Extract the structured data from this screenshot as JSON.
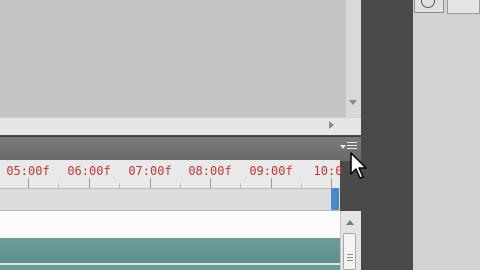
{
  "timeline": {
    "timecodes": [
      {
        "label": "05:00f"
      },
      {
        "label": "06:00f"
      },
      {
        "label": "07:00f"
      },
      {
        "label": "08:00f"
      },
      {
        "label": "09:00f"
      },
      {
        "label": "10:0"
      }
    ]
  },
  "icons": {
    "panel_menu": "panel-menu-icon",
    "cursor": "arrow-cursor-icon",
    "scroll_up": "scroll-up-arrow-icon",
    "scroll_down": "scroll-down-arrow-icon",
    "scroll_right": "scroll-right-arrow-icon"
  },
  "colors": {
    "timecode_text": "#c03a3a",
    "clip": "#6d9c97",
    "playhead": "#4a89c8",
    "background": "#4a4a4a"
  }
}
